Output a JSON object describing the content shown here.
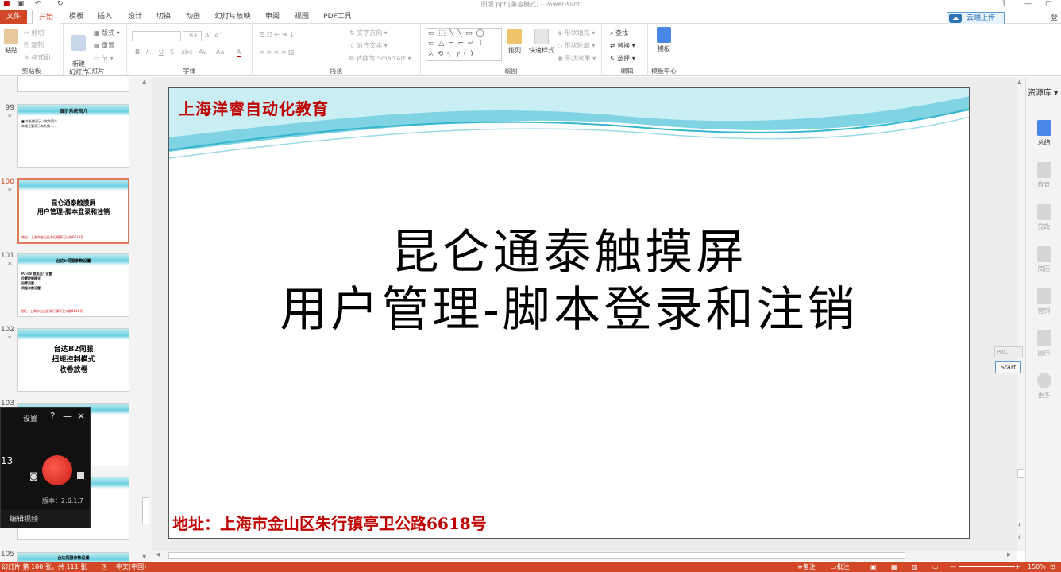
{
  "window": {
    "title": "旧版.ppt [兼容模式] - PowerPoint",
    "help": "?",
    "login": "登录"
  },
  "menu": {
    "tabs": [
      "文件",
      "开始",
      "模板",
      "插入",
      "设计",
      "切换",
      "动画",
      "幻灯片放映",
      "审阅",
      "视图",
      "PDF工具"
    ],
    "cloud_upload": "云端上传"
  },
  "ribbon": {
    "clipboard": {
      "paste": "粘贴",
      "cut": "剪切",
      "copy": "复制",
      "format_painter": "格式刷",
      "label": "剪贴板"
    },
    "slides": {
      "new_slide": "新建\n幻灯片",
      "layout": "版式",
      "reset": "重置",
      "section": "节",
      "label": "幻灯片"
    },
    "font": {
      "font_size": "18+",
      "label": "字体",
      "bold": "B",
      "italic": "I",
      "underline": "U",
      "shadow": "S",
      "strike": "abc",
      "spacing": "AV",
      "case": "Aa",
      "color": "A"
    },
    "paragraph": {
      "text_direction": "文字方向",
      "align_text": "对齐文本",
      "smartart": "转换为 SmartArt",
      "label": "段落"
    },
    "drawing": {
      "arrange": "排列",
      "quick_styles": "快速样式",
      "fill": "形状填充",
      "outline": "形状轮廓",
      "effects": "形状效果",
      "label": "绘图",
      "shapes_row1": "▭ ⬚ ╲ ╲ ▭ ◯",
      "shapes_row2": "▭ △ ⌐ ⌐ ⇨ ⇩",
      "shapes_row3": "◬ ⟲ ╮ ╭ ( )"
    },
    "editing": {
      "find": "查找",
      "replace": "替换",
      "select": "选择",
      "label": "编辑"
    },
    "template": {
      "template": "模板",
      "label": "模板中心"
    }
  },
  "thumbnails": [
    {
      "num": "99",
      "star": "*",
      "title": "演示系统简介",
      "lines": "■ 本系统演示 / 软件简介 ……\n本课主要演示本系统……"
    },
    {
      "num": "100",
      "star": "*",
      "title": "昆仑通泰触摸屏\n用户管理-脚本登录和注销",
      "footer": "地址：上海市金山区朱行镇亭卫公路6618号"
    },
    {
      "num": "101",
      "star": "*",
      "title": "台达E伺服参数设置",
      "lines": "P2-08 恢复出厂设置\n位置控制模式\n回零设置\n伺服参数设置",
      "footer": "地址：上海市金山区朱行镇亭卫公路6618号"
    },
    {
      "num": "102",
      "star": "*",
      "title": "台达B2伺服\n扭矩控制模式\n收卷放卷"
    },
    {
      "num": "103",
      "star": "*",
      "title": ""
    },
    {
      "num": "104",
      "star": "",
      "title": ""
    },
    {
      "num": "105",
      "star": "",
      "title": "台达伺服参数设置"
    }
  ],
  "recorder": {
    "settings": "设置",
    "help": "?",
    "minimize": "—",
    "close": "✕",
    "count": "13",
    "version": "版本：2.6.1.7",
    "edit_video": "编辑视频"
  },
  "slide": {
    "company": "上海洋睿自动化教育",
    "title_line1": "昆仑通泰触摸屏",
    "title_line2": "用户管理-脚本登录和注销",
    "address": "地址：上海市金山区朱行镇亭卫公路6618号"
  },
  "sidepane": {
    "title": "资源库",
    "items": [
      "总结",
      "教育",
      "党政",
      "简历",
      "营销",
      "图示",
      "更多"
    ]
  },
  "pointer_widget": {
    "label": "Poi...",
    "start": "Start"
  },
  "status": {
    "slide_info": "幻灯片 第 100 张，共 111 张",
    "language": "中文(中国)",
    "notes": "备注",
    "comments": "批注",
    "zoom": "150%"
  }
}
